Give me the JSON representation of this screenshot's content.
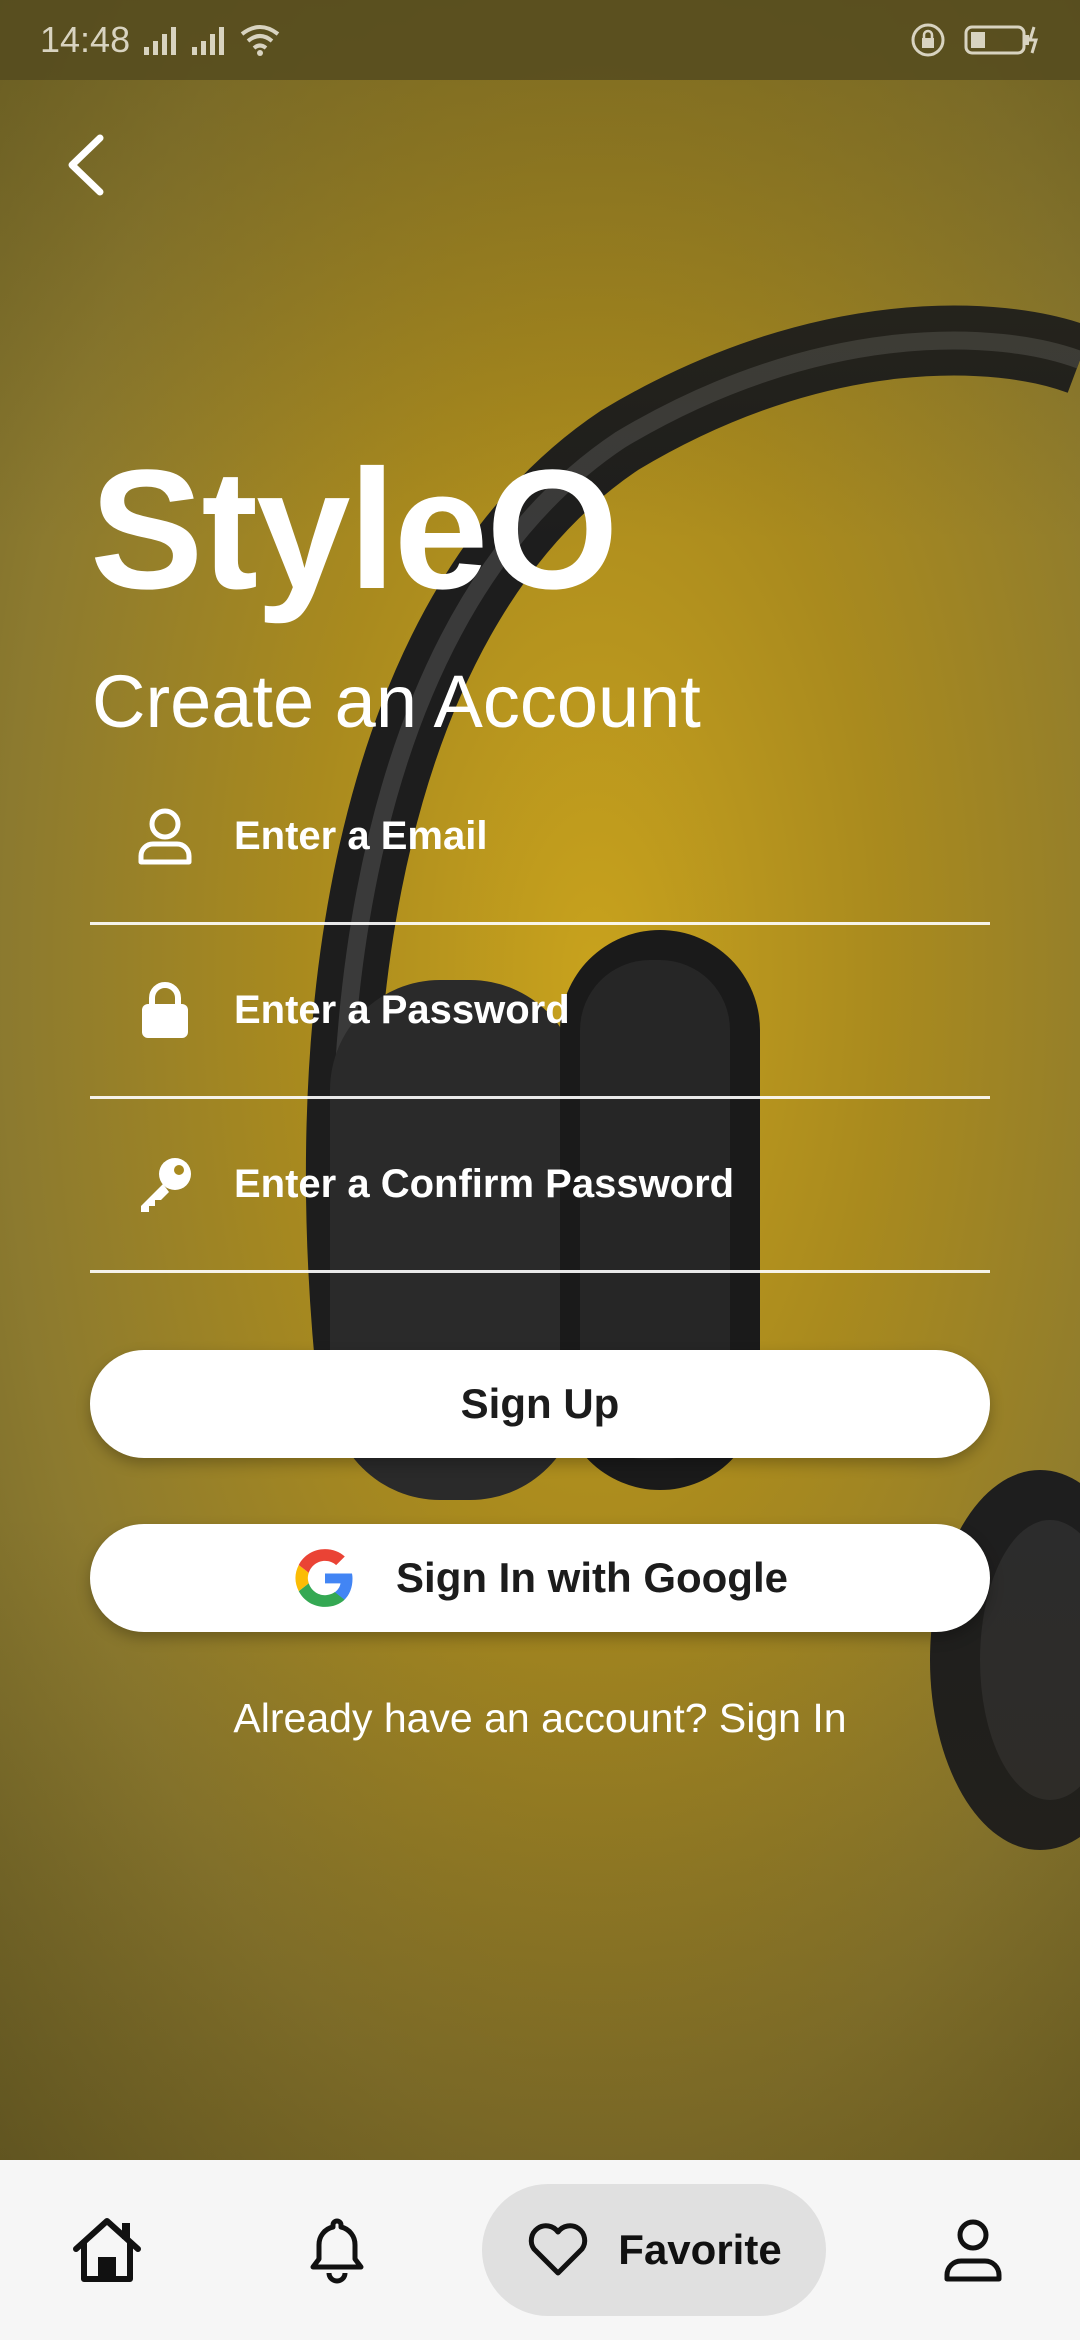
{
  "status_bar": {
    "time": "14:48",
    "icons": [
      "signal-icon",
      "signal-icon",
      "wifi-icon",
      "lock-rotation-icon",
      "battery-charging-icon"
    ]
  },
  "header": {
    "back_icon": "chevron-left-icon"
  },
  "brand": {
    "name": "StyleO"
  },
  "form": {
    "title": "Create an Account",
    "email_placeholder": "Enter a Email",
    "password_placeholder": "Enter a Password",
    "confirm_password_placeholder": "Enter a Confirm Password",
    "signup_label": "Sign Up",
    "google_label": "Sign In with Google",
    "signin_prompt": "Already have an account? Sign In"
  },
  "nav": {
    "items": [
      {
        "icon": "home-icon",
        "label": ""
      },
      {
        "icon": "bell-icon",
        "label": ""
      },
      {
        "icon": "heart-icon",
        "label": "Favorite"
      },
      {
        "icon": "user-icon",
        "label": ""
      }
    ],
    "active_index": 2
  },
  "colors": {
    "background": "#a98a1e",
    "button_bg": "#ffffff",
    "nav_bg": "#f6f6f6",
    "active_pill": "#e0e0e0"
  }
}
